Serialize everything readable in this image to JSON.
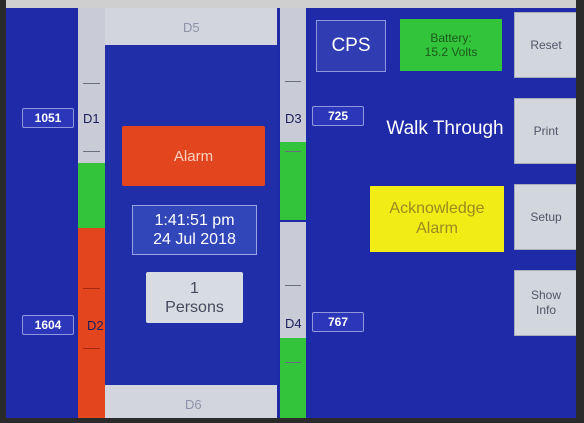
{
  "doors": {
    "d1": {
      "label": "D1",
      "count": "1051"
    },
    "d2": {
      "label": "D2",
      "count": "1604"
    },
    "d3": {
      "label": "D3",
      "count": "725"
    },
    "d4": {
      "label": "D4",
      "count": "767"
    },
    "d5": {
      "label": "D5"
    },
    "d6": {
      "label": "D6"
    }
  },
  "status": {
    "alarm_label": "Alarm",
    "time": "1:41:51 pm",
    "date": "24 Jul 2018",
    "persons_count": "1",
    "persons_label": "Persons"
  },
  "header": {
    "cps_label": "CPS",
    "battery_line1": "Battery:",
    "battery_line2": "15.2 Volts",
    "mode": "Walk Through"
  },
  "actions": {
    "acknowledge_line1": "Acknowledge",
    "acknowledge_line2": "Alarm"
  },
  "sidebar": {
    "reset": "Reset",
    "print": "Print",
    "setup": "Setup",
    "show_info_line1": "Show",
    "show_info_line2": "Info"
  },
  "colors": {
    "screen_bg": "#1f2aa8",
    "alarm_red": "#e3461f",
    "active_green": "#32c43a",
    "ack_yellow": "#f1ec16"
  }
}
